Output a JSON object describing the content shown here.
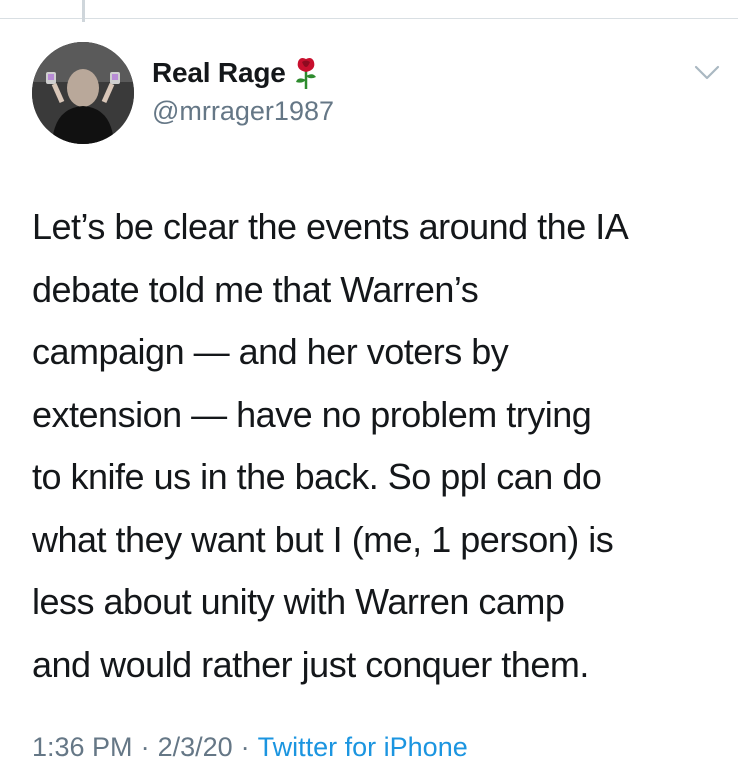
{
  "author": {
    "display_name": "Real Rage",
    "handle": "@mrrager1987",
    "name_emoji": "rose-icon",
    "avatar": "profile-photo"
  },
  "tweet": {
    "text": "Let’s be clear the events around the IA\ndebate told me that Warren’s\ncampaign — and her voters by\nextension — have no problem trying\nto knife us in the back. So ppl can do\nwhat they want but I (me, 1 person) is\nless about unity with Warren camp\nand would rather just conquer them."
  },
  "meta": {
    "time": "1:36 PM",
    "separator": "·",
    "date": "2/3/20",
    "source": "Twitter for iPhone"
  },
  "icons": {
    "menu": "chevron-down-icon"
  },
  "colors": {
    "text": "#14171a",
    "secondary": "#657786",
    "link": "#1b95e0",
    "divider": "#d9dfe3"
  }
}
